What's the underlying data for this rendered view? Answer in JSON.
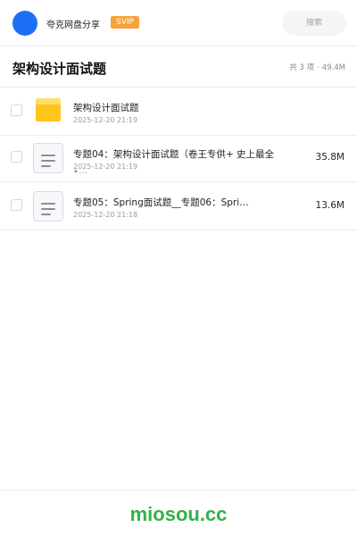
{
  "header": {
    "username": "夸克网盘分享",
    "badge": "SVIP",
    "search_placeholder": "搜索"
  },
  "titlebar": {
    "title": "架构设计面试题",
    "count": "共 3 项",
    "separator": "·",
    "total_size": "49.4M"
  },
  "files": [
    {
      "type": "folder",
      "name": "架构设计面试题",
      "date": "2025-12-20 21:19",
      "size": ""
    },
    {
      "type": "file",
      "name": "专题04：架构设计面试题（卷王专供+ 史上最全",
      "date": "2025-12-20 21:19",
      "size": "35.8M",
      "overflow": "+..."
    },
    {
      "type": "file",
      "name": "专题05：Spring面试题__专题06：Spri…",
      "date": "2025-12-20 21:18",
      "size": "13.6M"
    }
  ],
  "footer": {
    "brand": "miosou.cc"
  },
  "colors": {
    "avatar": "#1e6ff5",
    "svip": "#f5a33a",
    "folder": "#ffc41e",
    "brand": "#35b04a"
  }
}
